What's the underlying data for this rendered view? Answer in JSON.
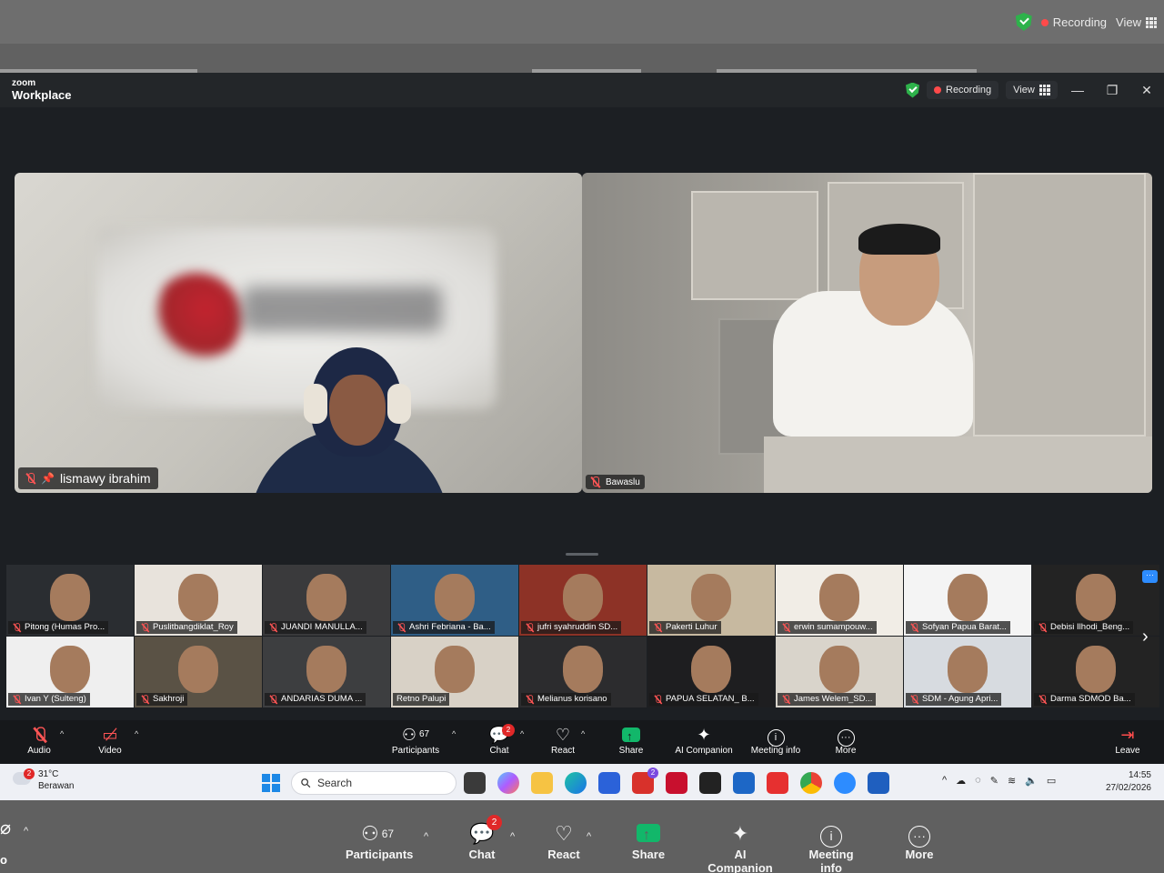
{
  "outer_bar": {
    "recording": "Recording",
    "view": "View"
  },
  "window": {
    "logo_small": "zoom",
    "logo_big": "Workplace",
    "recording": "Recording",
    "view": "View",
    "minimize": "—",
    "restore": "❐",
    "close": "✕"
  },
  "main_videos": [
    {
      "name": "lismawy ibrahim"
    },
    {
      "name": "Bawaslu"
    }
  ],
  "gallery": [
    {
      "name": "Pitong (Humas Pro...",
      "bg": "#2a2d31"
    },
    {
      "name": "Puslitbangdiklat_Roy",
      "bg": "#e8e3dc"
    },
    {
      "name": "JUANDI MANULLA...",
      "bg": "#3a3a3c"
    },
    {
      "name": "Ashri Febriana - Ba...",
      "bg": "#2f5e86"
    },
    {
      "name": "jufri syahruddin SD...",
      "bg": "#8d3226"
    },
    {
      "name": "Pakerti Luhur",
      "bg": "#c7b9a0"
    },
    {
      "name": "erwin sumampouw...",
      "bg": "#f1ede6"
    },
    {
      "name": "Sofyan Papua Barat...",
      "bg": "#f4f4f4"
    },
    {
      "name": "Debisi Ilhodi_Beng...",
      "bg": "#232323"
    },
    {
      "name": "Ivan Y (Sulteng)",
      "bg": "#efefef"
    },
    {
      "name": "Sakhroji",
      "bg": "#5a5245"
    },
    {
      "name": "ANDARIAS DUMA ...",
      "bg": "#3d3e40"
    },
    {
      "name": "Retno Palupi",
      "bg": "#d8d1c6"
    },
    {
      "name": "Melianus korisano",
      "bg": "#2c2c2e"
    },
    {
      "name": "PAPUA SELATAN_ B...",
      "bg": "#1e1e20"
    },
    {
      "name": "James Welem_SD...",
      "bg": "#d9d4cb"
    },
    {
      "name": "SDM - Agung Apri...",
      "bg": "#d7dbe0"
    },
    {
      "name": "Darma SDMOD Ba...",
      "bg": "#232323"
    }
  ],
  "toolbar": {
    "audio": "Audio",
    "video": "Video",
    "participants": "Participants",
    "participants_count": "67",
    "chat": "Chat",
    "chat_badge": "2",
    "react": "React",
    "share": "Share",
    "ai_companion": "AI Companion",
    "meeting_info": "Meeting info",
    "more": "More",
    "leave": "Leave"
  },
  "taskbar": {
    "temp": "31°C",
    "weather": "Berawan",
    "weather_badge": "2",
    "search_placeholder": "Search",
    "app_badge": "2",
    "time": "14:55",
    "date": "27/02/2026"
  },
  "outer_toolbar": {
    "audio_fragment": "o",
    "participants": "Participants",
    "participants_count": "67",
    "chat": "Chat",
    "chat_badge": "2",
    "react": "React",
    "share": "Share",
    "ai_companion": "AI Companion",
    "meeting_info": "Meeting info",
    "more": "More"
  }
}
